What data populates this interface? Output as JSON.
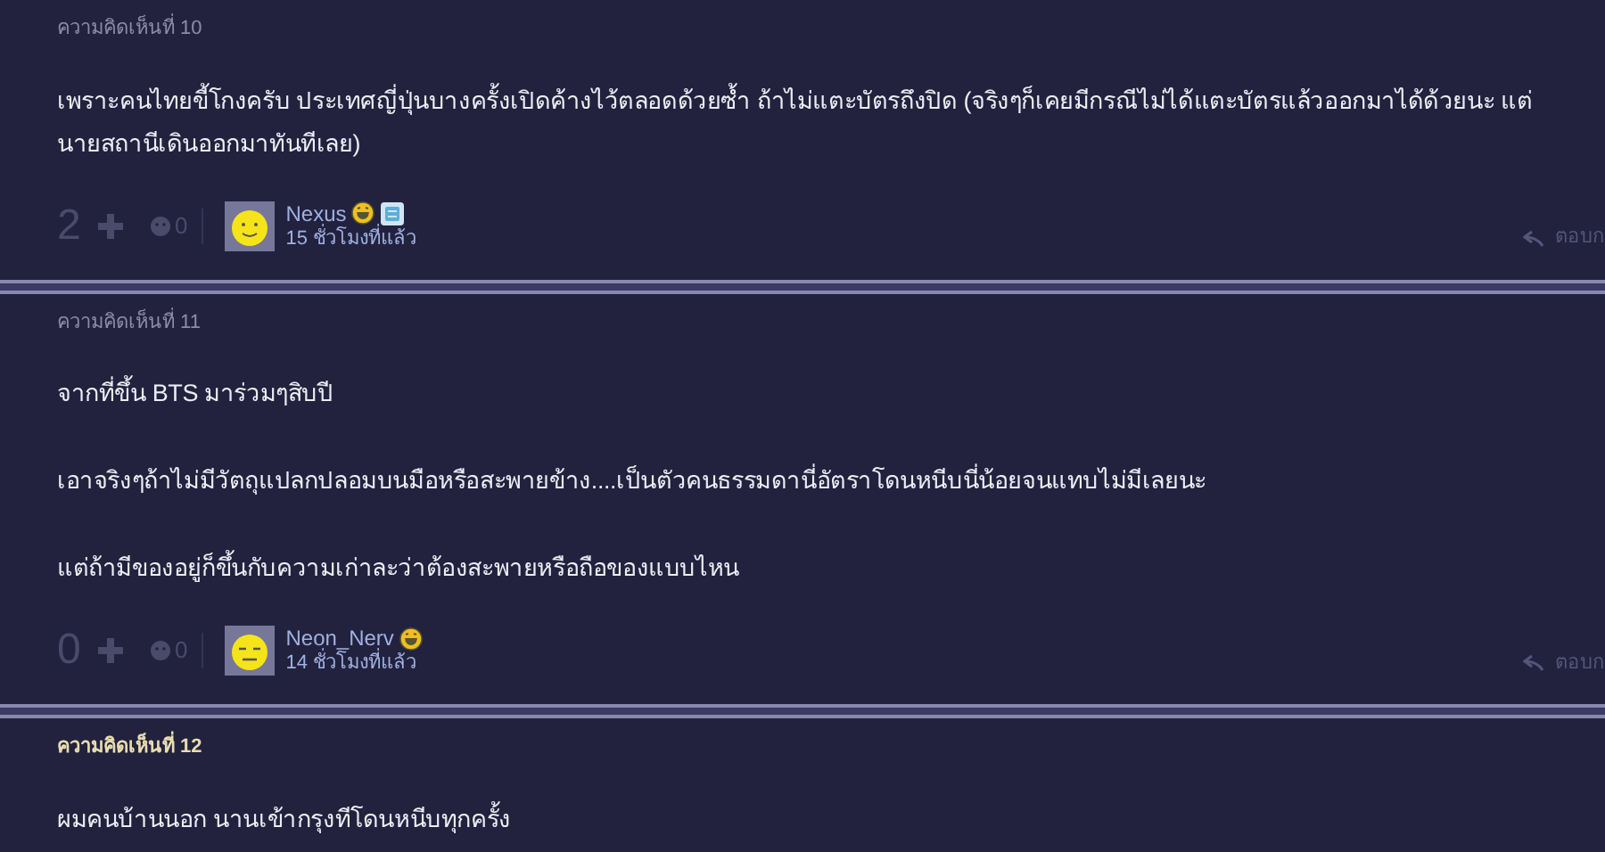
{
  "comments": [
    {
      "label": "ความคิดเห็นที่ 10",
      "label_highlighted": false,
      "paragraphs": [
        "เพราะคนไทยขี้โกงครับ ประเทศญี่ปุ่นบางครั้งเปิดค้างไว้ตลอดด้วยซ้ำ ถ้าไม่แตะบัตรถึงปิด (จริงๆก็เคยมีกรณีไม่ได้แตะบัตรแล้วออกมาได้ด้วยนะ แต่นายสถานีเดินออกมาทันทีเลย)"
      ],
      "footer": {
        "score": "2",
        "reactions": "0",
        "username": "Nexus",
        "avatar": {
          "kind": "smile"
        },
        "badges": [
          {
            "kind": "laugh"
          },
          {
            "kind": "member"
          }
        ],
        "time": "15 ชั่วโมงที่แล้ว",
        "reply": "ตอบก"
      }
    },
    {
      "label": "ความคิดเห็นที่ 11",
      "label_highlighted": false,
      "paragraphs": [
        "จากที่ขึ้น BTS มาร่วมๆสิบปี",
        "เอาจริงๆถ้าไม่มีวัตถุแปลกปลอมบนมือหรือสะพายข้าง....เป็นตัวคนธรรมดานี่อัตราโดนหนีบนี่น้อยจนแทบไม่มีเลยนะ",
        "แต่ถ้ามีของอยู่ก็ขึ้นกับความเก่าละว่าต้องสะพายหรือถือของแบบไหน"
      ],
      "footer": {
        "score": "0",
        "reactions": "0",
        "username": "Neon_Nerv",
        "avatar": {
          "kind": "sleepy"
        },
        "badges": [
          {
            "kind": "laugh"
          }
        ],
        "time": "14 ชั่วโมงที่แล้ว",
        "reply": "ตอบก"
      }
    },
    {
      "label": "ความคิดเห็นที่ 12",
      "label_highlighted": true,
      "paragraphs": [
        "ผมคนบ้านนอก นานเข้ากรุงทีโดนหนีบทุกครั้ง"
      ]
    }
  ]
}
